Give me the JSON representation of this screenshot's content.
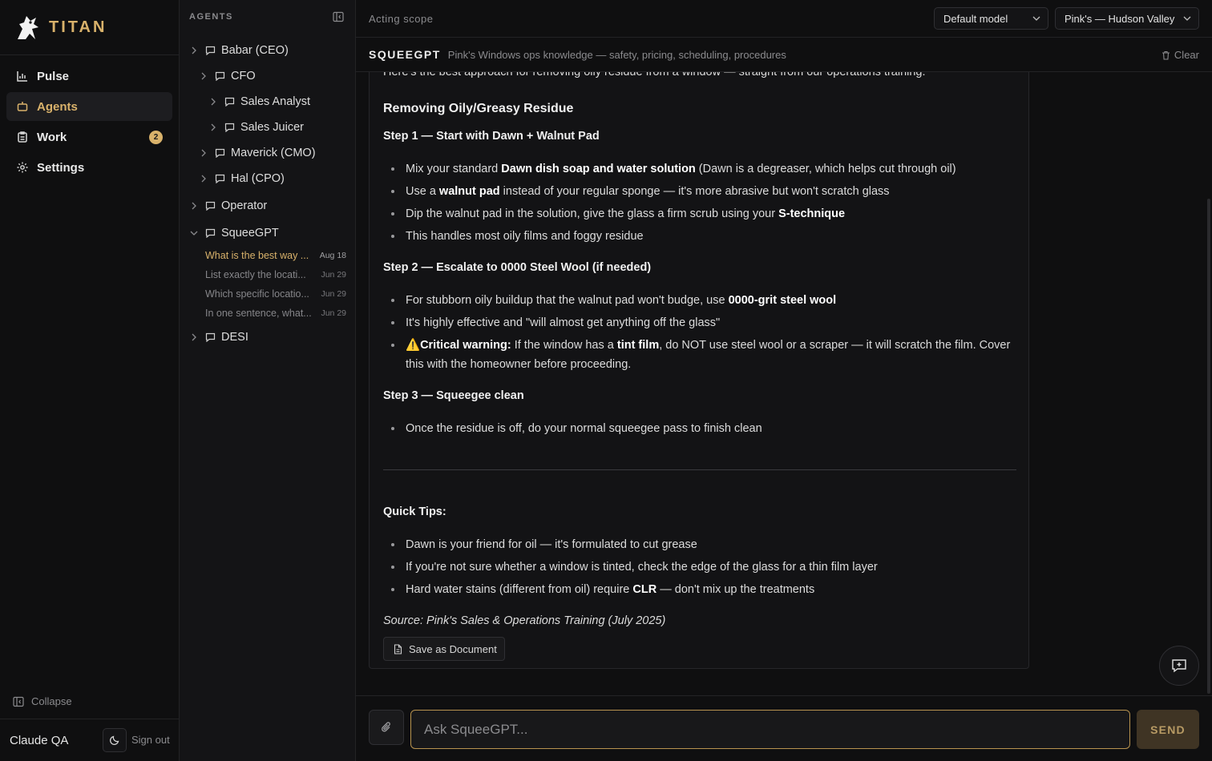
{
  "brand": {
    "name": "TITAN"
  },
  "nav": {
    "items": [
      {
        "label": "Pulse",
        "icon": "bar-chart-icon"
      },
      {
        "label": "Agents",
        "icon": "bot-icon",
        "active": true
      },
      {
        "label": "Work",
        "icon": "clipboard-icon",
        "badge": "2"
      },
      {
        "label": "Settings",
        "icon": "gear-icon"
      }
    ],
    "collapse_label": "Collapse",
    "user": "Claude QA",
    "signout": "Sign out"
  },
  "agents": {
    "header": "AGENTS",
    "tree": [
      {
        "label": "Babar (CEO)"
      },
      {
        "label": "CFO"
      },
      {
        "label": "Sales Analyst"
      },
      {
        "label": "Sales Juicer"
      },
      {
        "label": "Maverick (CMO)"
      },
      {
        "label": "Hal (CPO)"
      },
      {
        "label": "Operator"
      },
      {
        "label": "SqueeGPT"
      },
      {
        "label": "DESI"
      }
    ],
    "conversations": [
      {
        "title": "What is the best way ...",
        "date": "Aug 18",
        "active": true
      },
      {
        "title": "List exactly the locati...",
        "date": "Jun 29"
      },
      {
        "title": "Which specific locatio...",
        "date": "Jun 29"
      },
      {
        "title": "In one sentence, what...",
        "date": "Jun 29"
      }
    ]
  },
  "topbar": {
    "scope_label": "Acting scope",
    "model": "Default model",
    "scope": "Pink's — Hudson Valley"
  },
  "agent_header": {
    "name": "SQUEEGPT",
    "description": "Pink's Windows ops knowledge — safety, pricing, scheduling, procedures",
    "clear": "Clear"
  },
  "message": {
    "intro": "Here's the best approach for removing oily residue from a window — straight from our operations training:",
    "heading": "Removing Oily/Greasy Residue",
    "step1": {
      "title": "Step 1 — Start with Dawn + Walnut Pad",
      "bullets": [
        [
          "Mix your standard ",
          "Dawn dish soap and water solution",
          " (Dawn is a degreaser, which helps cut through oil)"
        ],
        [
          "Use a ",
          "walnut pad",
          " instead of your regular sponge — it's more abrasive but won't scratch glass"
        ],
        [
          "Dip the walnut pad in the solution, give the glass a firm scrub using your ",
          "S-technique",
          ""
        ],
        [
          "This handles most oily films and foggy residue",
          "",
          ""
        ]
      ]
    },
    "step2": {
      "title": "Step 2 — Escalate to 0000 Steel Wool (if needed)",
      "bullets": [
        [
          "For stubborn oily buildup that the walnut pad won't budge, use ",
          "0000-grit steel wool",
          ""
        ],
        [
          "It's highly effective and \"will almost get anything off the glass\"",
          "",
          ""
        ]
      ],
      "warning": {
        "emoji": "⚠️",
        "label": "Critical warning:",
        "pre": " If the window has a ",
        "bold": "tint film",
        "post": ", do NOT use steel wool or a scraper — it will scratch the film. Cover this with the homeowner before proceeding."
      }
    },
    "step3": {
      "title": "Step 3 — Squeegee clean",
      "bullets": [
        [
          "Once the residue is off, do your normal squeegee pass to finish clean",
          "",
          ""
        ]
      ]
    },
    "tips": {
      "title": "Quick Tips:",
      "bullets": [
        [
          "Dawn is your friend for oil — it's formulated to cut grease",
          "",
          ""
        ],
        [
          "If you're not sure whether a window is tinted, check the edge of the glass for a thin film layer",
          "",
          ""
        ],
        [
          "Hard water stains (different from oil) require ",
          "CLR",
          " — don't mix up the treatments"
        ]
      ]
    },
    "source": "Source: Pink's Sales & Operations Training (July 2025)",
    "save_label": "Save as Document"
  },
  "composer": {
    "placeholder": "Ask SqueeGPT...",
    "send": "SEND"
  }
}
